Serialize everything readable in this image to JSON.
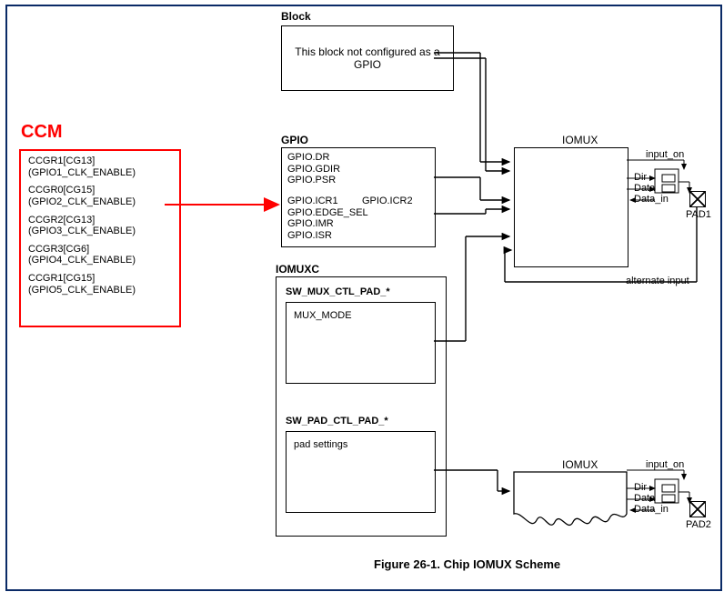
{
  "figure_caption": "Figure 26-1. Chip IOMUX Scheme",
  "ccm": {
    "title": "CCM",
    "items": [
      {
        "reg": "CCGR1[CG13]",
        "sig": "(GPIO1_CLK_ENABLE)"
      },
      {
        "reg": "CCGR0[CG15]",
        "sig": "(GPIO2_CLK_ENABLE)"
      },
      {
        "reg": "CCGR2[CG13]",
        "sig": "(GPIO3_CLK_ENABLE)"
      },
      {
        "reg": "CCGR3[CG6]",
        "sig": "(GPIO4_CLK_ENABLE)"
      },
      {
        "reg": "CCGR1[CG15]",
        "sig": "(GPIO5_CLK_ENABLE)"
      }
    ]
  },
  "block": {
    "title": "Block",
    "text": "This block not configured as a GPIO"
  },
  "gpio": {
    "title": "GPIO",
    "regs_left": [
      "GPIO.DR",
      "GPIO.GDIR",
      "GPIO.PSR"
    ],
    "regs_bot_left": [
      "GPIO.ICR1",
      "GPIO.EDGE_SEL",
      "GPIO.IMR",
      "GPIO.ISR"
    ],
    "regs_bot_right": "GPIO.ICR2"
  },
  "iomuxc": {
    "title": "IOMUXC",
    "sw_mux": {
      "title": "SW_MUX_CTL_PAD_*",
      "field": "MUX_MODE"
    },
    "sw_pad": {
      "title": "SW_PAD_CTL_PAD_*",
      "field": "pad settings"
    }
  },
  "iomux": {
    "title": "IOMUX",
    "sig_input_on": "input_on",
    "sig_dir": "Dir",
    "sig_data_out": "Data_out",
    "sig_data_in": "Data_in",
    "alt_input": "alternate input",
    "pad1": "PAD1",
    "pad2": "PAD2"
  }
}
